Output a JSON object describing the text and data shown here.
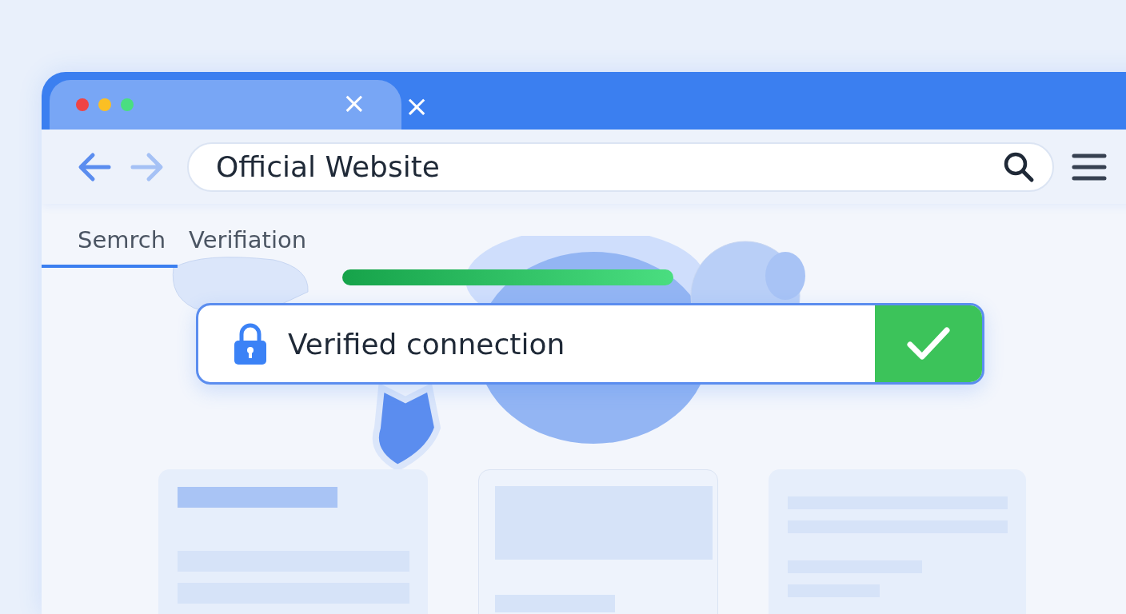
{
  "browser_tabs": [
    {
      "close": "×",
      "selected": true
    },
    {
      "close": "×",
      "selected": false
    }
  ],
  "toolbar": {
    "address": {
      "value": "Official Website"
    }
  },
  "page_tabs": [
    {
      "label": "Semrch",
      "selected": true
    },
    {
      "label": "Verifiation",
      "selected": false
    }
  ],
  "banner": {
    "text": "Verified connection",
    "verified": true
  }
}
